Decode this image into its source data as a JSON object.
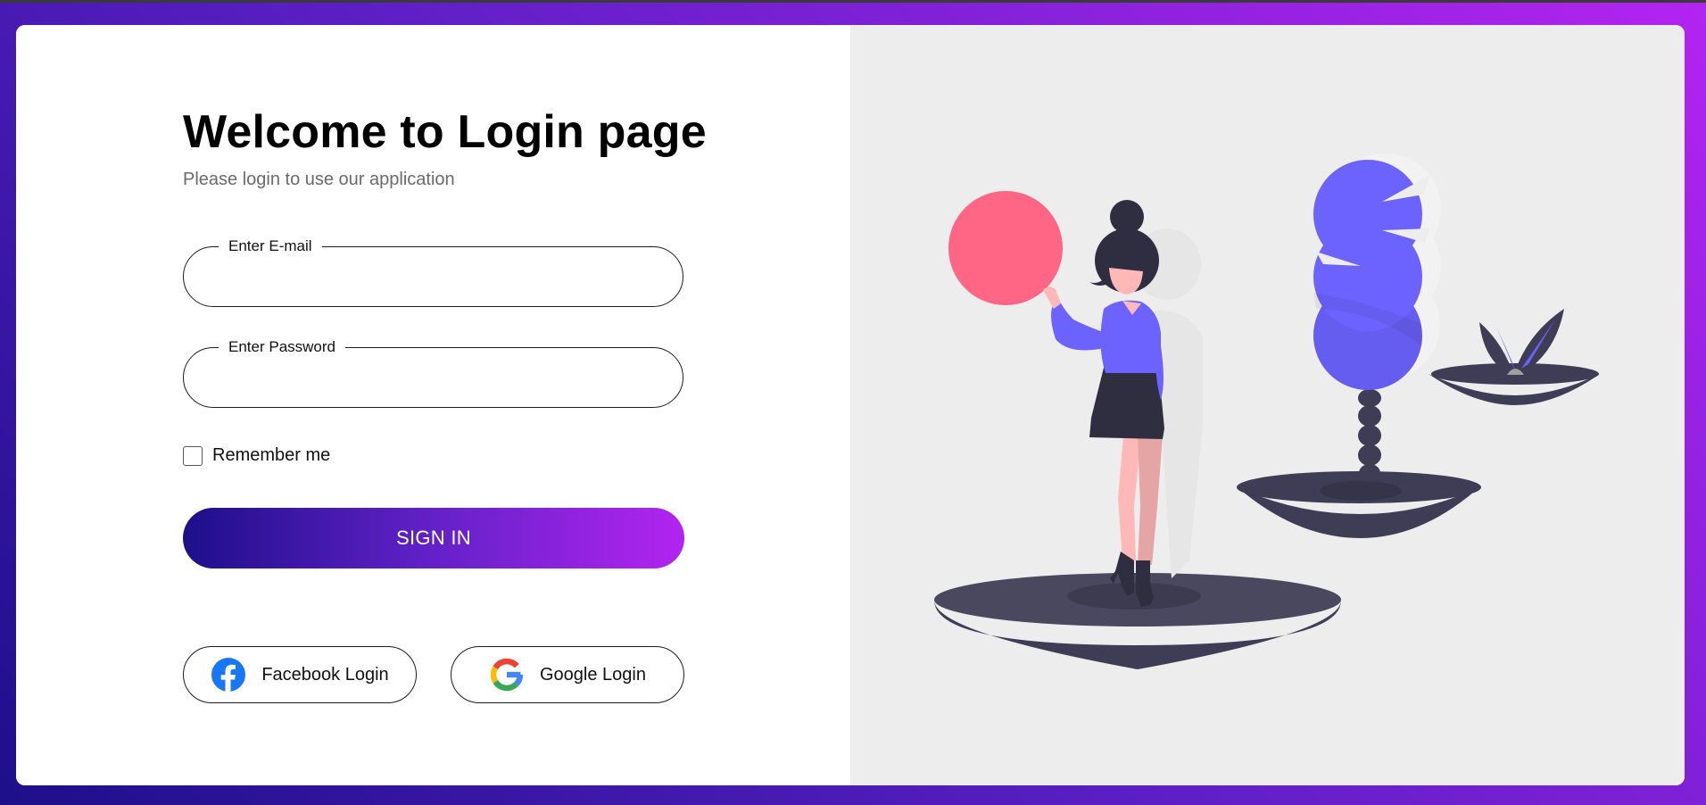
{
  "header": {
    "title": "Welcome to Login page",
    "subtitle": "Please login to use our application"
  },
  "form": {
    "email_label": "Enter E-mail",
    "email_value": "",
    "password_label": "Enter Password",
    "password_value": "",
    "remember_label": "Remember me",
    "remember_checked": false,
    "submit_label": "SIGN IN"
  },
  "social": {
    "facebook_label": "Facebook Login",
    "google_label": "Google Login",
    "facebook_icon": "facebook-icon",
    "google_icon": "google-icon"
  },
  "colors": {
    "gradient_start": "#1d0f8a",
    "gradient_end": "#b324f0",
    "accent_purple": "#6c63ff",
    "accent_pink": "#ff6584",
    "dark": "#3f3d56",
    "illustration_bg": "#ededed"
  },
  "illustration": {
    "name": "woman-holding-ball-with-trees-illustration"
  }
}
